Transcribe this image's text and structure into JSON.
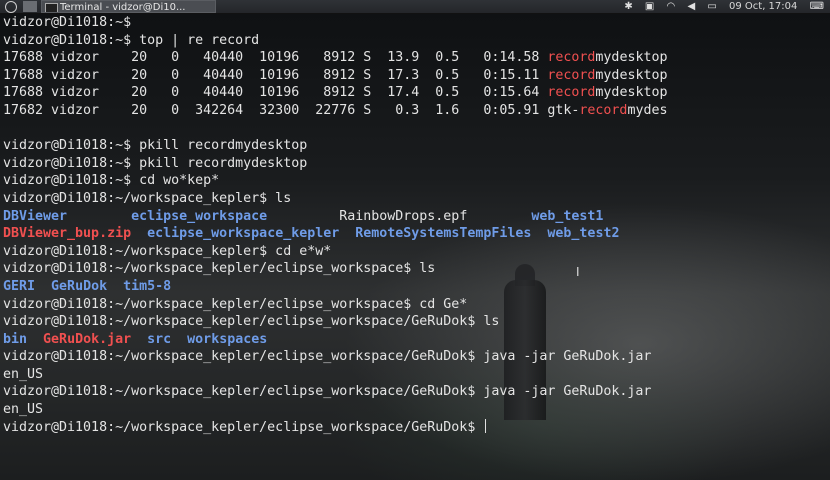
{
  "panel": {
    "task_title": "Terminal - vidzor@Di10...",
    "clock": "09 Oct, 17:04",
    "tray_icons": [
      "bluetooth-icon",
      "window-icon",
      "wifi-icon",
      "speaker-icon",
      "battery-icon",
      "keyboard-layout-icon"
    ]
  },
  "terminal": {
    "lines": [
      [
        {
          "t": "vidzor@Di1018:~$"
        }
      ],
      [
        {
          "t": "vidzor@Di1018:~$ top | re record"
        }
      ],
      [
        {
          "t": "17688 vidzor    20   0   40440  10196   8912 S  13.9  0.5   0:14.58 "
        },
        {
          "t": "record",
          "c": "red"
        },
        {
          "t": "mydesktop"
        }
      ],
      [
        {
          "t": "17688 vidzor    20   0   40440  10196   8912 S  17.3  0.5   0:15.11 "
        },
        {
          "t": "record",
          "c": "red"
        },
        {
          "t": "mydesktop"
        }
      ],
      [
        {
          "t": "17688 vidzor    20   0   40440  10196   8912 S  17.4  0.5   0:15.64 "
        },
        {
          "t": "record",
          "c": "red"
        },
        {
          "t": "mydesktop"
        }
      ],
      [
        {
          "t": "17682 vidzor    20   0  342264  32300  22776 S   0.3  1.6   0:05.91 gtk-"
        },
        {
          "t": "record",
          "c": "red"
        },
        {
          "t": "mydes"
        }
      ],
      [
        {
          "t": ""
        }
      ],
      [
        {
          "t": "vidzor@Di1018:~$ pkill recordmydesktop"
        }
      ],
      [
        {
          "t": "vidzor@Di1018:~$ pkill recordmydesktop"
        }
      ],
      [
        {
          "t": "vidzor@Di1018:~$ cd wo*kep*"
        }
      ],
      [
        {
          "t": "vidzor@Di1018:~/workspace_kepler$ ls"
        }
      ],
      [
        {
          "t": "DBViewer",
          "c": "blue"
        },
        {
          "t": "        "
        },
        {
          "t": "eclipse_workspace",
          "c": "blue"
        },
        {
          "t": "         RainbowDrops.epf        "
        },
        {
          "t": "web_test1",
          "c": "blue"
        }
      ],
      [
        {
          "t": "DBViewer_bup.zip",
          "c": "redb"
        },
        {
          "t": "  "
        },
        {
          "t": "eclipse_workspace_kepler",
          "c": "blue"
        },
        {
          "t": "  "
        },
        {
          "t": "RemoteSystemsTempFiles",
          "c": "blue"
        },
        {
          "t": "  "
        },
        {
          "t": "web_test2",
          "c": "blue"
        }
      ],
      [
        {
          "t": "vidzor@Di1018:~/workspace_kepler$ cd e*w*"
        }
      ],
      [
        {
          "t": "vidzor@Di1018:~/workspace_kepler/eclipse_workspace$ ls"
        }
      ],
      [
        {
          "t": "GERI",
          "c": "blue"
        },
        {
          "t": "  "
        },
        {
          "t": "GeRuDok",
          "c": "blue"
        },
        {
          "t": "  "
        },
        {
          "t": "tim5-8",
          "c": "blue"
        }
      ],
      [
        {
          "t": "vidzor@Di1018:~/workspace_kepler/eclipse_workspace$ cd Ge*"
        }
      ],
      [
        {
          "t": "vidzor@Di1018:~/workspace_kepler/eclipse_workspace/GeRuDok$ ls"
        }
      ],
      [
        {
          "t": "bin",
          "c": "blue"
        },
        {
          "t": "  "
        },
        {
          "t": "GeRuDok.jar",
          "c": "redb"
        },
        {
          "t": "  "
        },
        {
          "t": "src",
          "c": "blue"
        },
        {
          "t": "  "
        },
        {
          "t": "workspaces",
          "c": "blue"
        }
      ],
      [
        {
          "t": "vidzor@Di1018:~/workspace_kepler/eclipse_workspace/GeRuDok$ java -jar GeRuDok.jar"
        }
      ],
      [
        {
          "t": "en_US"
        }
      ],
      [
        {
          "t": "vidzor@Di1018:~/workspace_kepler/eclipse_workspace/GeRuDok$ java -jar GeRuDok.jar"
        }
      ],
      [
        {
          "t": "en_US"
        }
      ],
      [
        {
          "t": "vidzor@Di1018:~/workspace_kepler/eclipse_workspace/GeRuDok$ "
        }
      ]
    ]
  }
}
